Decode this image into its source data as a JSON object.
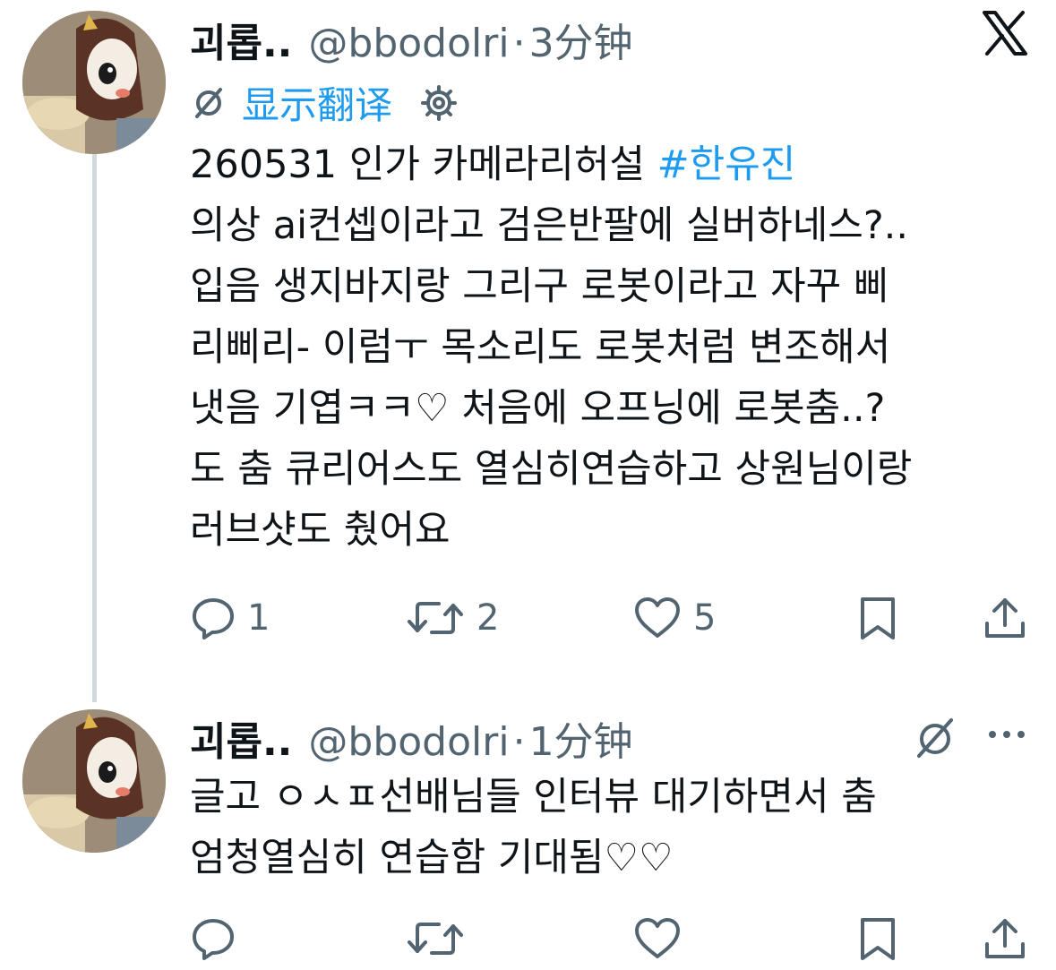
{
  "tweets": [
    {
      "author": "괴롭..",
      "handle": "@bbodolri",
      "separator": "·",
      "time": "3分钟",
      "translate_label": "显示翻译",
      "text_line1_prefix": "260531 인가 카메라리허설 ",
      "hashtag": "#한유진",
      "text_lines": [
        "의상 ai컨셉이라고 검은반팔에 실버하네스?..",
        "입음 생지바지랑 그리구 로봇이라고 자꾸 삐",
        "리삐리- 이럼ㅜ 목소리도 로봇처럼 변조해서",
        "냇음 기엽ㅋㅋ♡ 처음에 오프닝에 로봇춤..?",
        "도 춤 큐리어스도 열심히연습하고 상원님이랑",
        "러브샷도 췄어요"
      ],
      "reply_count": "1",
      "retweet_count": "2",
      "like_count": "5"
    },
    {
      "author": "괴롭..",
      "handle": "@bbodolri",
      "separator": "·",
      "time": "1分钟",
      "text_lines": [
        "글고 ㅇㅅㅍ선배님들 인터뷰 대기하면서 춤",
        "엄청열심히 연습함 기대됨♡♡"
      ]
    }
  ],
  "colors": {
    "link": "#1d9bf0",
    "secondary": "#536471",
    "text": "#0f1419",
    "thread_line": "#cfd9de"
  },
  "icons": [
    "x-logo-icon",
    "translate-icon",
    "gear-icon",
    "reply-icon",
    "retweet-icon",
    "like-icon",
    "bookmark-icon",
    "share-icon"
  ]
}
